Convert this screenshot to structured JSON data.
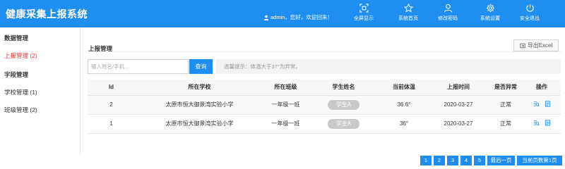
{
  "app": {
    "title": "健康采集上报系统"
  },
  "user": {
    "greeting": "admin，您好，欢迎回来！"
  },
  "nav": [
    {
      "label": "全屏显示",
      "icon": "fullscreen-icon"
    },
    {
      "label": "系统首页",
      "icon": "star-icon"
    },
    {
      "label": "修改密码",
      "icon": "user-icon"
    },
    {
      "label": "系统设置",
      "icon": "gear-icon"
    },
    {
      "label": "安全退出",
      "icon": "power-icon"
    }
  ],
  "sidebar": {
    "groups": [
      {
        "title": "数据管理",
        "items": [
          {
            "label": "上报管理 (2)",
            "active": true
          }
        ]
      },
      {
        "title": "字段管理",
        "items": [
          {
            "label": "学校管理 (1)"
          },
          {
            "label": "班级管理 (2)"
          }
        ]
      }
    ]
  },
  "main": {
    "section_title": "上报管理",
    "export_label": "导出Excel",
    "search": {
      "placeholder": "输入姓名/手机...",
      "value": "",
      "button": "查询"
    },
    "tip": "温馨提示：体温大于37°为异常。",
    "table": {
      "columns": [
        "Id",
        "所在学校",
        "所在班级",
        "学生姓名",
        "当前体温",
        "上报时间",
        "是否异常",
        "操作"
      ],
      "rows": [
        {
          "id": "2",
          "school": "太原市恒大御景湾实验小学",
          "class": "一年级一班",
          "student": "学生A",
          "temp": "36.6°",
          "time": "2020-03-27",
          "abnormal": "正常"
        },
        {
          "id": "1",
          "school": "太原市恒大御景湾实验小学",
          "class": "一年级一班",
          "student": "学生A",
          "temp": "36°",
          "time": "2020-03-27",
          "abnormal": "正常"
        }
      ]
    },
    "pager": {
      "pages": [
        "1",
        "2",
        "3",
        "4",
        "5"
      ],
      "last": "最后一页",
      "current": "当前页数第1页"
    }
  },
  "colors": {
    "primary": "#1e8ff1",
    "active_red": "#e4393c",
    "tag_gray": "#c9c9c9"
  }
}
